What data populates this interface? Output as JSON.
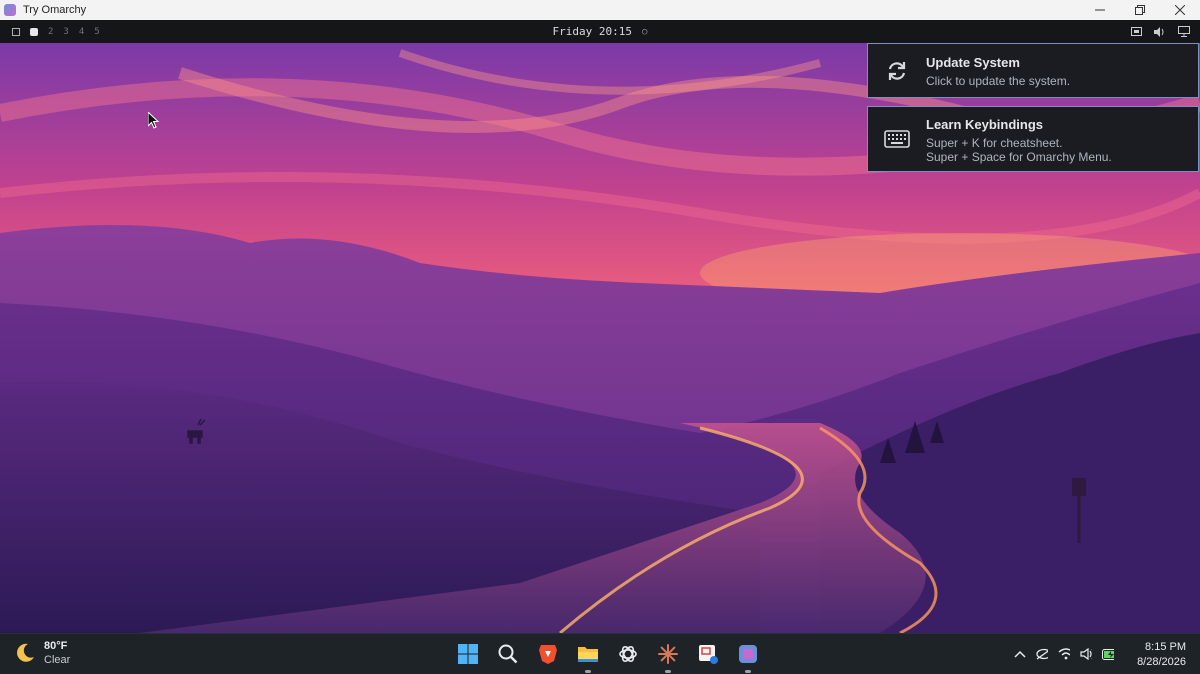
{
  "window": {
    "title": "Try Omarchy",
    "minimize_icon": "minimize-icon",
    "restore_icon": "restore-icon",
    "close_icon": "close-icon"
  },
  "topbar": {
    "workspaces": [
      "2",
      "3",
      "4",
      "5"
    ],
    "clock": "Friday 20:15",
    "tray_icons": [
      "screen-icon",
      "volume-icon",
      "monitor-icon"
    ]
  },
  "notifications": [
    {
      "title": "Update System",
      "lines": [
        "Click to update the system."
      ],
      "icon": "refresh-icon"
    },
    {
      "title": "Learn Keybindings",
      "lines": [
        "Super + K for cheatsheet.",
        "Super + Space for Omarchy Menu."
      ],
      "icon": "keyboard-icon"
    }
  ],
  "taskbar": {
    "weather": {
      "temp": "80°F",
      "condition": "Clear",
      "icon": "moon-icon"
    },
    "apps": [
      "windows-start-icon",
      "search-icon",
      "brave-icon",
      "file-explorer-icon",
      "chatgpt-icon",
      "claude-icon",
      "snipping-tool-icon",
      "omarchy-app-icon"
    ],
    "tray": [
      "chevron-up-icon",
      "eye-off-icon",
      "wifi-icon",
      "speaker-icon",
      "battery-icon"
    ],
    "time": "8:15 PM",
    "date": "8/28/2026"
  },
  "colors": {
    "notification_border": "#7f8fbf",
    "topbar_bg": "#141618",
    "taskbar_bg": "#1e2328"
  }
}
